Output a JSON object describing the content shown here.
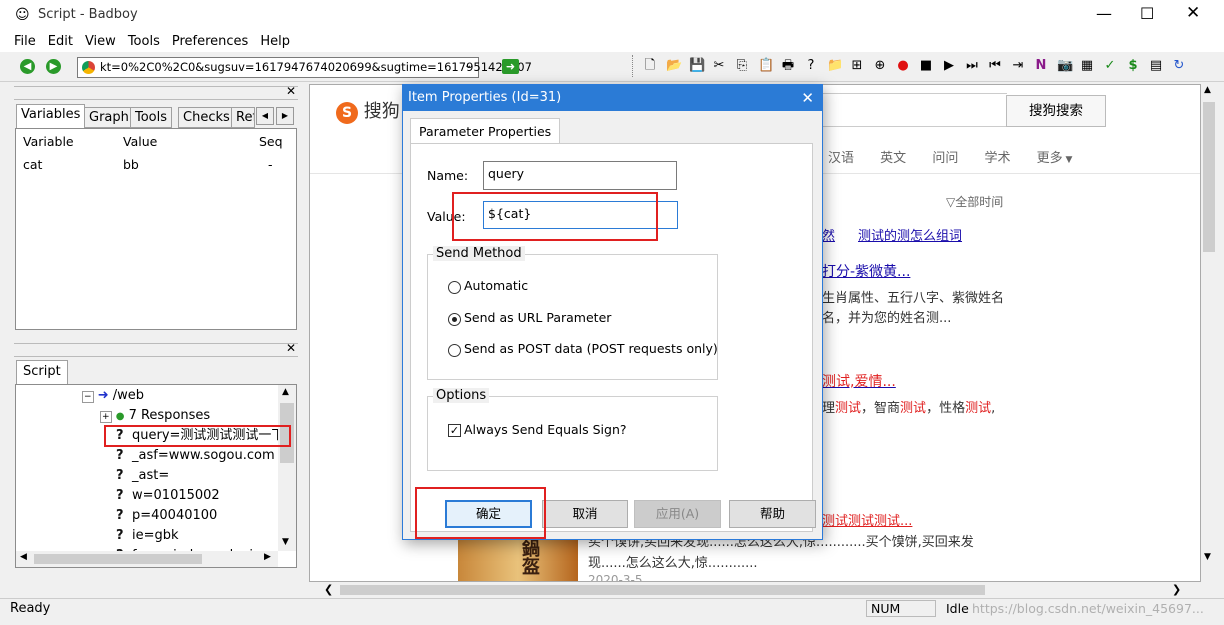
{
  "window": {
    "title": "Script - Badboy"
  },
  "menu": [
    "File",
    "Edit",
    "View",
    "Tools",
    "Preferences",
    "Help"
  ],
  "address": {
    "value": "kt=0%2C0%2C0&sugsuv=1617947674020699&sugtime=1617951421207"
  },
  "left_panel": {
    "tabs": [
      "Variables",
      "Graph",
      "Tools",
      "Checks",
      "Ref"
    ],
    "columns": [
      "Variable",
      "Value",
      "Seq"
    ],
    "rows": [
      {
        "variable": "cat",
        "value": "bb",
        "seq": "-"
      }
    ]
  },
  "script_panel": {
    "tab": "Script",
    "items": [
      "/web",
      "7 Responses",
      "query=测试测试测试一下",
      "_asf=www.sogou.com",
      "_ast=",
      "w=01015002",
      "p=40040100",
      "ie=gbk",
      "from=index-nologin"
    ]
  },
  "browser": {
    "logo": "搜狗",
    "search_button": "搜狗搜索",
    "nav": [
      "汉语",
      "英文",
      "问问",
      "学术",
      "更多"
    ],
    "time_filter": "全部时间",
    "related": [
      "然",
      "测试的测怎么组词"
    ],
    "result1": {
      "link": "打分-紫微黄...",
      "line1": "生肖属性、五行八字、紫微姓名",
      "line2": "名，并为您的姓名测..."
    },
    "result2": {
      "link_pre": "测试,爱情...",
      "line1_a": "理",
      "line1_b": "测试",
      "line1_c": "，智商",
      "line1_d": "测试",
      "line1_e": "，性格",
      "line1_f": "测试",
      "line1_g": ","
    },
    "result3": {
      "link": "测试测试测试...",
      "line1": "买个馍饼,买回来发现......怎么这么大,惊............买个馍饼,买回来发",
      "line2": "现......怎么这么大,惊............",
      "date": "2020-3-5",
      "img_text": "鍋盔"
    }
  },
  "dialog": {
    "title": "Item Properties (Id=31)",
    "tab": "Parameter Properties",
    "name_label": "Name:",
    "name_value": "query",
    "value_label": "Value:",
    "value_value": "${cat}",
    "send_method": {
      "legend": "Send Method",
      "options": [
        "Automatic",
        "Send as URL Parameter",
        "Send as POST data (POST requests only)"
      ],
      "selected": 1
    },
    "options_group": {
      "legend": "Options",
      "checkbox": "Always Send Equals Sign?",
      "checked": true
    },
    "buttons": [
      "确定",
      "取消",
      "应用(A)",
      "帮助"
    ]
  },
  "status": {
    "left": "Ready",
    "num": "NUM",
    "state": "Idle",
    "watermark": "https://blog.csdn.net/weixin_45697..."
  },
  "colors": {
    "accent": "#2b7bd6",
    "highlight": "#e02020",
    "link": "#1a0dab"
  }
}
